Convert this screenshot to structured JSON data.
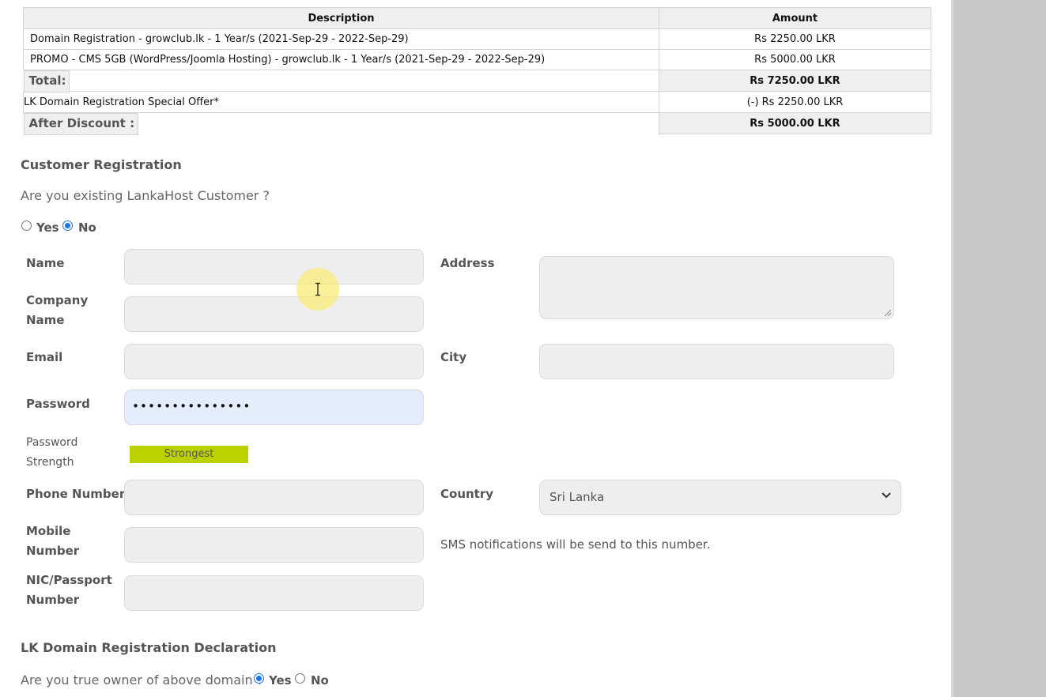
{
  "invoice": {
    "headers": {
      "description": "Description",
      "amount": "Amount"
    },
    "items": [
      {
        "description": "Domain Registration - growclub.lk - 1 Year/s (2021-Sep-29 - 2022-Sep-29)",
        "amount": "Rs 2250.00 LKR"
      },
      {
        "description": "PROMO - CMS 5GB (WordPress/Joomla Hosting) - growclub.lk - 1 Year/s (2021-Sep-29 - 2022-Sep-29)",
        "amount": "Rs 5000.00 LKR"
      }
    ],
    "total_label": "Total:",
    "total_value": "Rs 7250.00 LKR",
    "offer_label": "LK Domain Registration Special Offer*",
    "offer_value": "(-) Rs 2250.00 LKR",
    "after_label": "After Discount :",
    "after_value": "Rs 5000.00 LKR"
  },
  "registration": {
    "heading": "Customer Registration",
    "existing_question": "Are you existing LankaHost Customer ?",
    "yes_label": "Yes",
    "no_label": "No",
    "existing_selected": "No"
  },
  "form": {
    "name_label": "Name",
    "company_label_1": "Company",
    "company_label_2": "Name",
    "email_label": "Email",
    "password_label": "Password",
    "password_value": "•••••••••••••••",
    "strength_label_1": "Password",
    "strength_label_2": "Strength",
    "strength_value": "Strongest",
    "phone_label": "Phone Number",
    "mobile_label_1": "Mobile",
    "mobile_label_2": "Number",
    "nic_label_1": "NIC/Passport",
    "nic_label_2": "Number",
    "address_label": "Address",
    "city_label": "City",
    "country_label": "Country",
    "country_value": "Sri Lanka",
    "sms_hint": "SMS notifications will be send to this number."
  },
  "declaration": {
    "heading": "LK Domain Registration Declaration",
    "question": "Are you true owner of above domain ?",
    "yes_label": "Yes",
    "no_label": "No",
    "selected": "Yes"
  },
  "icons": {
    "cursor": "text-cursor-icon",
    "select_arrow": "chevron-down-icon"
  },
  "colors": {
    "strength_bar": "#bcd200",
    "radio_selected": "#1a73e8",
    "cursor_highlight": "#faec78"
  }
}
